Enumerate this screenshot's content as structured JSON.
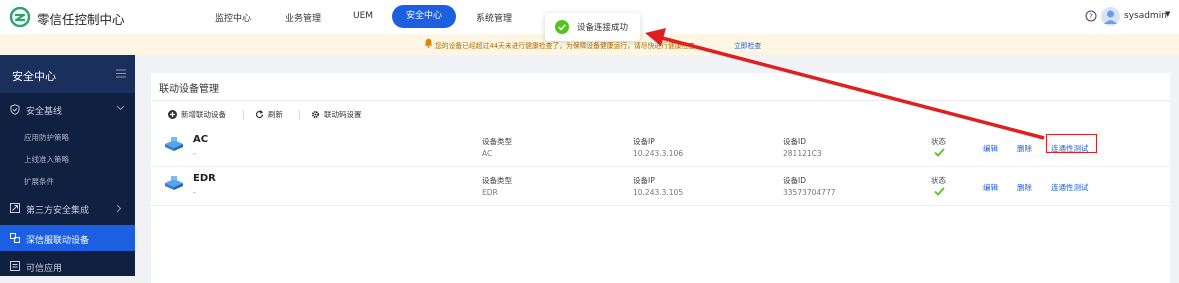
{
  "app": {
    "title": "零信任控制中心"
  },
  "nav": {
    "items": [
      "监控中心",
      "业务管理",
      "UEM",
      "安全中心",
      "系统管理"
    ],
    "active": "安全中心"
  },
  "user": {
    "name": "sysadmin"
  },
  "notice": {
    "text": "您的设备已经超过44天未进行健康检查了，为保障设备健康运行，请尽快进行健康检查",
    "link": "立即检查"
  },
  "toast": {
    "text": "设备连接成功"
  },
  "sidebar": {
    "title": "安全中心",
    "groups": [
      {
        "label": "安全基线",
        "icon": "shield-icon",
        "expanded": true,
        "items": [
          "应用防护策略",
          "上线准入策略",
          "扩展条件"
        ]
      },
      {
        "label": "第三方安全集成",
        "icon": "integration-icon"
      },
      {
        "label": "深信服联动设备",
        "icon": "link-device-icon",
        "active": true
      },
      {
        "label": "可信应用",
        "icon": "app-icon"
      }
    ]
  },
  "main": {
    "title": "联动设备管理",
    "toolbar": {
      "add": "新增联动设备",
      "refresh": "刷新",
      "settings": "联动码设置"
    },
    "rows": [
      {
        "name": "AC",
        "sub": "-",
        "type_label": "设备类型",
        "type": "AC",
        "ip_label": "设备IP",
        "ip": "10.243.3.106",
        "id_label": "设备ID",
        "id": "281121C3",
        "status_label": "状态",
        "actions": [
          "编辑",
          "删除",
          "连通性测试"
        ]
      },
      {
        "name": "EDR",
        "sub": "-",
        "type_label": "设备类型",
        "type": "EDR",
        "ip_label": "设备IP",
        "ip": "10.243.3.105",
        "id_label": "设备ID",
        "id": "33573704777",
        "status_label": "状态",
        "actions": [
          "编辑",
          "删除",
          "连通性测试"
        ]
      }
    ]
  },
  "colors": {
    "primary": "#1c5fe0",
    "sidebar": "#102041",
    "success": "#52c41a",
    "annotation": "#e02020"
  }
}
